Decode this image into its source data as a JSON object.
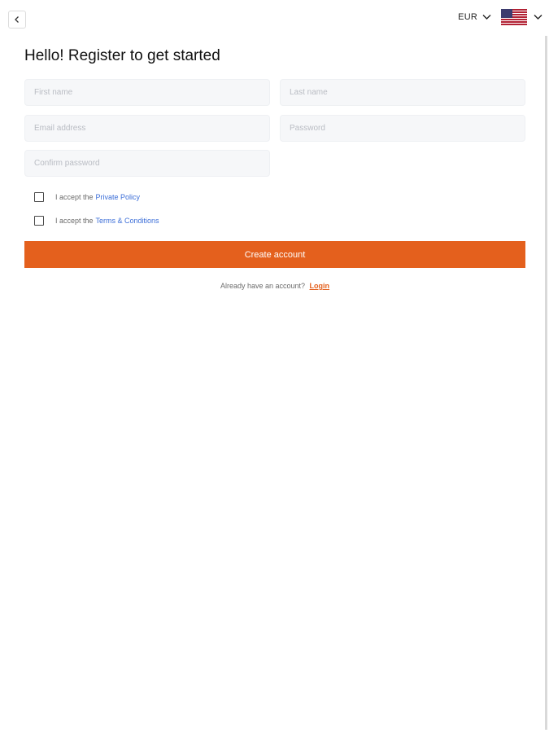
{
  "header": {
    "back_icon": "chevron-left-icon",
    "currency": {
      "label": "EUR",
      "icon": "chevron-down-icon"
    },
    "language": {
      "flag": "us-flag-icon",
      "icon": "chevron-down-icon"
    }
  },
  "form": {
    "title": "Hello! Register to get started",
    "fields": {
      "first_name": {
        "placeholder": "First name",
        "value": ""
      },
      "last_name": {
        "placeholder": "Last name",
        "value": ""
      },
      "email": {
        "placeholder": "Email address",
        "value": ""
      },
      "password": {
        "placeholder": "Password",
        "value": ""
      },
      "confirm_password": {
        "placeholder": "Confirm password",
        "value": ""
      }
    },
    "privacy": {
      "prefix": "I accept the",
      "link": "Private Policy",
      "checked": false
    },
    "terms": {
      "prefix": "I accept the",
      "link": "Terms & Conditions",
      "checked": false
    },
    "submit_label": "Create account",
    "login_prompt": "Already have an account?",
    "login_link": "Login"
  },
  "colors": {
    "accent": "#e4601d",
    "link": "#3d6fd8",
    "input_bg": "#f6f7f9"
  }
}
